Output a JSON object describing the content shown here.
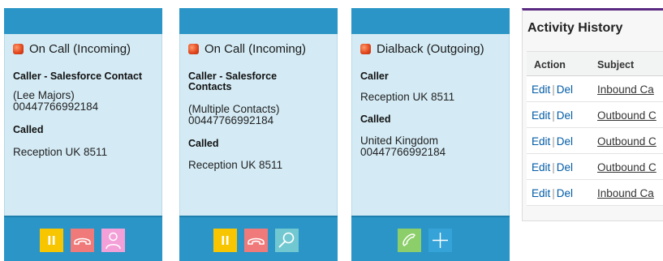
{
  "panels": [
    {
      "status": "On Call (Incoming)",
      "caller_label": "Caller - Salesforce Contact",
      "caller_value": "(Lee Majors)\n00447766992184",
      "called_label": "Called",
      "called_value": "Reception UK 8511",
      "buttons": [
        {
          "name": "hold-button",
          "icon": "pause-icon",
          "color": "#f7c600"
        },
        {
          "name": "hangup-button",
          "icon": "phone-hangup-icon",
          "color": "#f07a7a"
        },
        {
          "name": "contact-button",
          "icon": "person-icon",
          "color": "#f4a0d8"
        }
      ]
    },
    {
      "status": "On Call (Incoming)",
      "caller_label": "Caller - Salesforce\nContacts",
      "caller_value": "(Multiple Contacts)\n00447766992184",
      "called_label": "Called",
      "called_value": "Reception UK 8511",
      "buttons": [
        {
          "name": "hold-button",
          "icon": "pause-icon",
          "color": "#f7c600"
        },
        {
          "name": "hangup-button",
          "icon": "phone-hangup-icon",
          "color": "#f07a7a"
        },
        {
          "name": "search-button",
          "icon": "search-icon",
          "color": "#72c8d0"
        }
      ]
    },
    {
      "status": "Dialback (Outgoing)",
      "caller_label": "Caller",
      "caller_value": "Reception UK 8511",
      "called_label": "Called",
      "called_value": "United Kingdom\n00447766992184",
      "buttons": [
        {
          "name": "dial-button",
          "icon": "phone-icon",
          "color": "#8ccf6a"
        },
        {
          "name": "add-button",
          "icon": "plus-icon",
          "color": "#35a3d8"
        }
      ]
    }
  ],
  "activity": {
    "title": "Activity History",
    "columns": {
      "action": "Action",
      "subject": "Subject"
    },
    "edit_label": "Edit",
    "sep": "|",
    "del_label": "Del",
    "rows": [
      {
        "subject": "Inbound Ca"
      },
      {
        "subject": "Outbound C"
      },
      {
        "subject": "Outbound C"
      },
      {
        "subject": "Outbound C"
      },
      {
        "subject": "Inbound Ca"
      }
    ]
  }
}
